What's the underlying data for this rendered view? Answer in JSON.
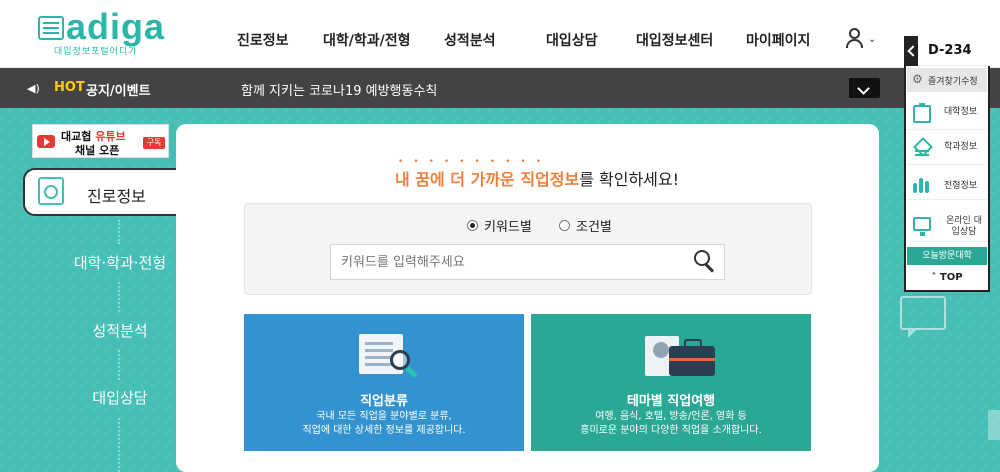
{
  "brand": {
    "logo_text": "adiga",
    "logo_sub": "대입정보포털어디가"
  },
  "nav": {
    "items": [
      "진로정보",
      "대학/학과/전형",
      "성적분석",
      "대입상담",
      "대입정보센터",
      "마이페이지"
    ]
  },
  "notice_bar": {
    "hot_label": "HOT",
    "title": "공지/이벤트",
    "message": "함께 지키는 코로나19 예방행동수칙"
  },
  "banner": {
    "line1_prefix": "대교협",
    "line1_highlight": "유튜브",
    "line2": "채널 오픈",
    "subscribe": "구독"
  },
  "side_menu": {
    "active": "진로정보",
    "items": [
      "대학·학과·전형",
      "성적분석",
      "대입상담"
    ]
  },
  "hero": {
    "highlight": "내 꿈에 더 가까운 직업정보",
    "suffix": "를 확인하세요!"
  },
  "search": {
    "option_keyword": "키워드별",
    "option_condition": "조건별",
    "selected": "키워드별",
    "placeholder": "키워드를 입력해주세요"
  },
  "tiles": [
    {
      "title": "직업분류",
      "desc_line1": "국내 모든 직업을 분야별로 분류,",
      "desc_line2": "직업에 대한 상세한 정보를 제공합니다."
    },
    {
      "title": "테마별 직업여행",
      "desc_line1": "여행, 음식, 호텔, 방송/언론, 영화 등",
      "desc_line2": "흥미로운 분야의 다양한 직업을 소개합니다."
    }
  ],
  "quick_menu": {
    "dday": "D-234",
    "favorites": "즐겨찾기수정",
    "items": [
      {
        "label": "대학정보"
      },
      {
        "label": "학과정보"
      },
      {
        "label": "전형정보"
      },
      {
        "label": "온라인 대입상담"
      }
    ],
    "today_visit": "오늘방문대학",
    "top": "TOP"
  },
  "colors": {
    "teal": "#45bfb5",
    "orange": "#f07f3c",
    "blue_tile": "#3393d0",
    "green_tile": "#2aa895",
    "dark_bar": "#434343"
  }
}
